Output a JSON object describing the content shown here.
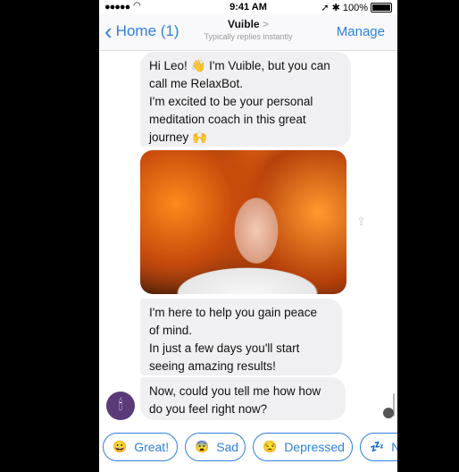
{
  "status_bar": {
    "signal": "●●●●●",
    "time": "9:41 AM",
    "battery": "100%"
  },
  "nav": {
    "back_label": "Home (1)",
    "title": "Vuible",
    "title_chevron": ">",
    "subtitle": "Typically replies instantly",
    "manage_label": "Manage"
  },
  "messages": [
    {
      "lines": [
        "Hi Leo! 👋 I'm Vuible, but you can",
        "call me RelaxBot.",
        "I'm excited to be your personal",
        "meditation coach in this great",
        "journey 🙌"
      ]
    },
    {
      "lines": [
        "I'm here to help you gain peace",
        "of mind.",
        "In just a few days you'll start",
        "seeing amazing results!"
      ]
    },
    {
      "lines": [
        "Now, could you tell me how how",
        "do you feel right now?"
      ]
    }
  ],
  "quick_replies": [
    {
      "emoji": "😀",
      "label": "Great!"
    },
    {
      "emoji": "😨",
      "label": "Sad"
    },
    {
      "emoji": "😒",
      "label": "Depressed"
    },
    {
      "emoji": "💤",
      "label": "N"
    }
  ],
  "icons": {
    "back": "chevron-left-icon",
    "share": "share-icon",
    "avatar": "bot-avatar"
  },
  "colors": {
    "accent": "#2f80e0",
    "bubble": "#f0f0f2"
  }
}
